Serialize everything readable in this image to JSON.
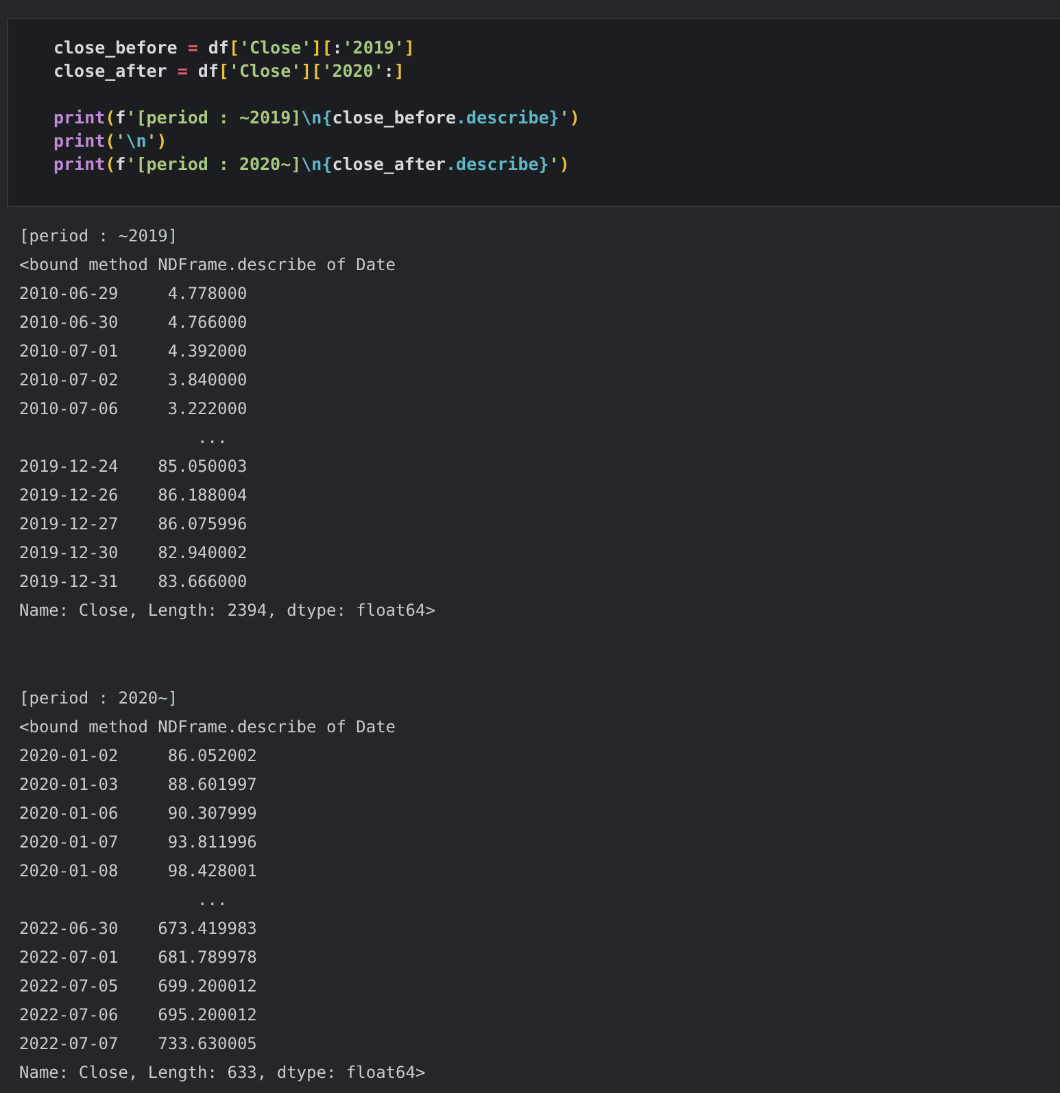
{
  "code_cell": {
    "blocks": [
      [
        [
          {
            "kind": "name",
            "text": "close_before "
          },
          {
            "kind": "op",
            "text": "="
          },
          {
            "kind": "name",
            "text": " df"
          },
          {
            "kind": "bracket",
            "text": "["
          },
          {
            "kind": "string",
            "text": "'Close'"
          },
          {
            "kind": "bracket",
            "text": "]["
          },
          {
            "kind": "name",
            "text": ":"
          },
          {
            "kind": "string",
            "text": "'2019'"
          },
          {
            "kind": "bracket",
            "text": "]"
          }
        ],
        [
          {
            "kind": "name",
            "text": "close_after "
          },
          {
            "kind": "op",
            "text": "="
          },
          {
            "kind": "name",
            "text": " df"
          },
          {
            "kind": "bracket",
            "text": "["
          },
          {
            "kind": "string",
            "text": "'Close'"
          },
          {
            "kind": "bracket",
            "text": "]["
          },
          {
            "kind": "string",
            "text": "'2020'"
          },
          {
            "kind": "name",
            "text": ":"
          },
          {
            "kind": "bracket",
            "text": "]"
          }
        ]
      ],
      [
        [
          {
            "kind": "func",
            "text": "print"
          },
          {
            "kind": "bracket",
            "text": "("
          },
          {
            "kind": "name",
            "text": "f"
          },
          {
            "kind": "string",
            "text": "'[period : ~2019]"
          },
          {
            "kind": "method",
            "text": "\\n{"
          },
          {
            "kind": "name",
            "text": "close_before"
          },
          {
            "kind": "method",
            "text": ".describe}"
          },
          {
            "kind": "string",
            "text": "'"
          },
          {
            "kind": "bracket",
            "text": ")"
          }
        ],
        [
          {
            "kind": "func",
            "text": "print"
          },
          {
            "kind": "bracket",
            "text": "("
          },
          {
            "kind": "string",
            "text": "'"
          },
          {
            "kind": "method",
            "text": "\\n"
          },
          {
            "kind": "string",
            "text": "'"
          },
          {
            "kind": "bracket",
            "text": ")"
          }
        ],
        [
          {
            "kind": "func",
            "text": "print"
          },
          {
            "kind": "bracket",
            "text": "("
          },
          {
            "kind": "name",
            "text": "f"
          },
          {
            "kind": "string",
            "text": "'[period : 2020~]"
          },
          {
            "kind": "method",
            "text": "\\n{"
          },
          {
            "kind": "name",
            "text": "close_after"
          },
          {
            "kind": "method",
            "text": ".describe}"
          },
          {
            "kind": "string",
            "text": "'"
          },
          {
            "kind": "bracket",
            "text": ")"
          }
        ]
      ]
    ]
  },
  "output": [
    {
      "lines": [
        "[period : ~2019]",
        "<bound method NDFrame.describe of Date",
        "2010-06-29     4.778000",
        "2010-06-30     4.766000",
        "2010-07-01     4.392000",
        "2010-07-02     3.840000",
        "2010-07-06     3.222000",
        "                  ...",
        "2019-12-24    85.050003",
        "2019-12-26    86.188004",
        "2019-12-27    86.075996",
        "2019-12-30    82.940002",
        "2019-12-31    83.666000",
        "Name: Close, Length: 2394, dtype: float64>"
      ]
    },
    {
      "lines": [
        "[period : 2020~]",
        "<bound method NDFrame.describe of Date",
        "2020-01-02     86.052002",
        "2020-01-03     88.601997",
        "2020-01-06     90.307999",
        "2020-01-07     93.811996",
        "2020-01-08     98.428001",
        "                  ...",
        "2022-06-30    673.419983",
        "2022-07-01    681.789978",
        "2022-07-05    699.200012",
        "2022-07-06    695.200012",
        "2022-07-07    733.630005",
        "Name: Close, Length: 633, dtype: float64>"
      ]
    }
  ]
}
